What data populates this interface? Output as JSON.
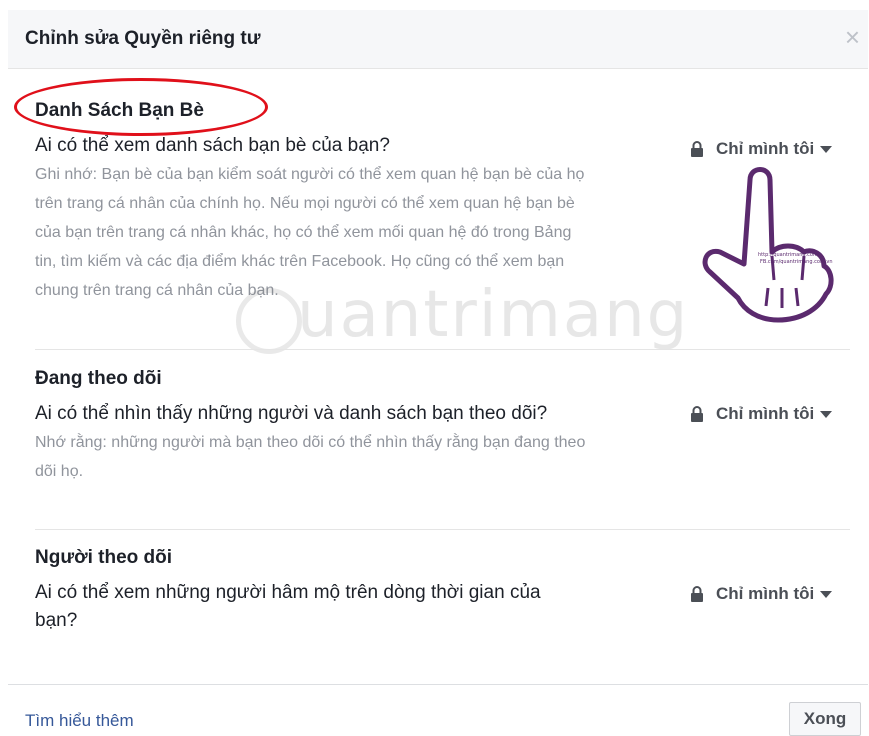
{
  "dialog": {
    "title": "Chỉnh sửa Quyền riêng tư",
    "close_icon": "close-icon"
  },
  "sections": [
    {
      "title": "Danh Sách Bạn Bè",
      "question": "Ai có thể xem danh sách bạn bè của bạn?",
      "note": "Ghi nhớ: Bạn bè của bạn kiểm soát người có thể xem quan hệ bạn bè của họ trên trang cá nhân của chính họ. Nếu mọi người có thể xem quan hệ bạn bè của bạn trên trang cá nhân khác, họ có thể xem mối quan hệ đó trong Bảng tin, tìm kiếm và các địa điểm khác trên Facebook. Họ cũng có thể xem bạn chung trên trang cá nhân của bạn.",
      "audience": "Chỉ mình tôi"
    },
    {
      "title": "Đang theo dõi",
      "question": "Ai có thể nhìn thấy những người và danh sách bạn theo dõi?",
      "note": "Nhớ rằng: những người mà bạn theo dõi có thể nhìn thấy rằng bạn đang theo dõi họ.",
      "audience": "Chỉ mình tôi"
    },
    {
      "title": "Người theo dõi",
      "question": "Ai có thể xem những người hâm mộ trên dòng thời gian của bạn?",
      "audience": "Chỉ mình tôi"
    }
  ],
  "footer": {
    "learn_more": "Tìm hiểu thêm",
    "done": "Xong"
  },
  "overlay": {
    "watermark": "uantrimang",
    "hand_text_1": "http://quantrimang.com/",
    "hand_text_2": "FB.com/quantrimang.com.vn"
  },
  "colors": {
    "highlight_ellipse": "#e0101a",
    "hand_outline": "#5b2a6e",
    "link": "#365899"
  }
}
